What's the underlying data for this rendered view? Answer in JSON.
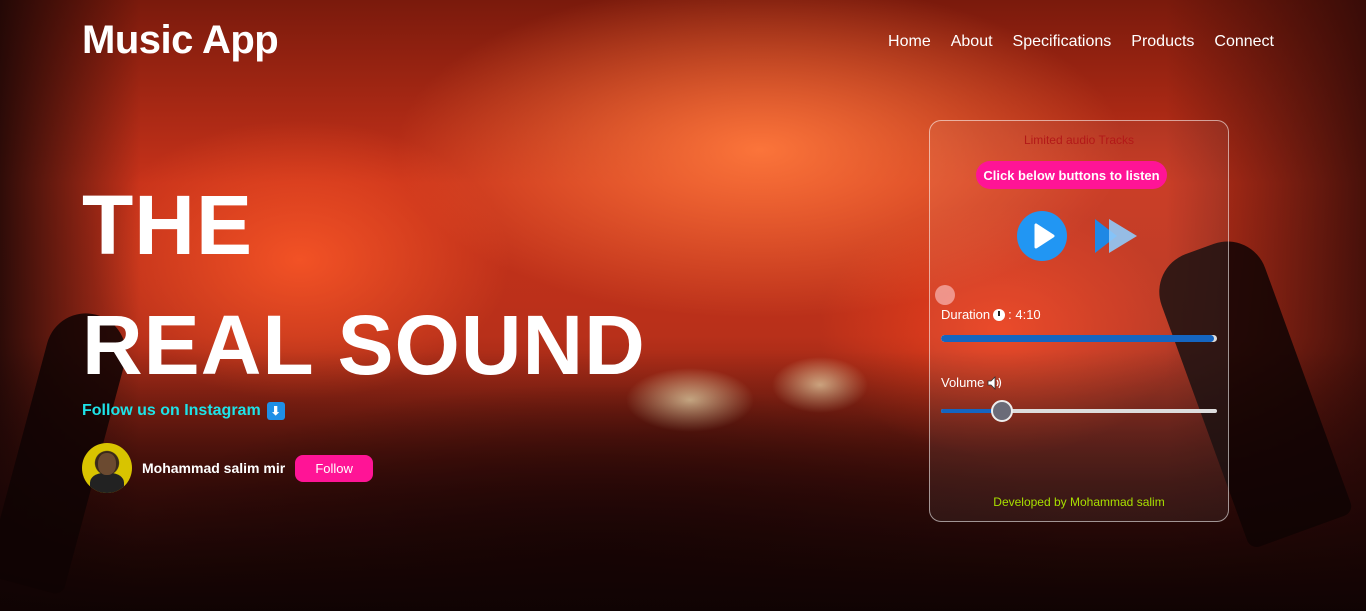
{
  "app": {
    "logo": "Music App"
  },
  "nav": {
    "items": [
      "Home",
      "About",
      "Specifications",
      "Products",
      "Connect"
    ]
  },
  "hero": {
    "line1": "THE",
    "line2": "REAL SOUND"
  },
  "social": {
    "instagram_text": "Follow us on Instagram",
    "arrow_glyph": "⬇",
    "profile_name": "Mohammad salim mir",
    "follow_label": "Follow"
  },
  "player": {
    "heading": "Limited audio Tracks",
    "listen_label": "Click below buttons to listen",
    "duration_label": "Duration",
    "duration_value": ": 4:10",
    "duration_progress": 0.99,
    "volume_label": "Volume",
    "volume_level": 0.22,
    "footer": "Developed by Mohammad salim"
  },
  "colors": {
    "accent_pink": "#ff1496",
    "instagram_cyan": "#1ee3e8",
    "play_blue": "#2196f3",
    "progress_blue": "#1565c0",
    "developer_green": "#a8e000",
    "heading_red": "#b31818"
  },
  "icons": {
    "play": "play-icon",
    "next": "next-icon",
    "clock": "clock-icon",
    "speaker": "speaker-icon",
    "arrow": "down-arrow-icon"
  }
}
